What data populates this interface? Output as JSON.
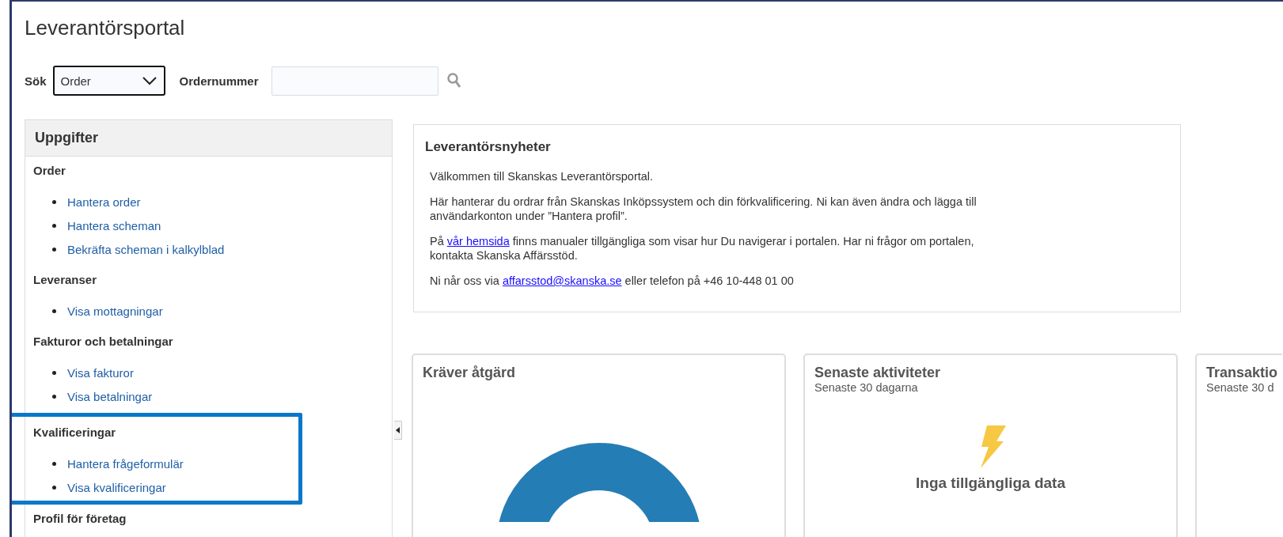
{
  "page": {
    "title": "Leverantörsportal"
  },
  "search": {
    "label": "Sök",
    "select_value": "Order",
    "field_label": "Ordernummer"
  },
  "tasks": {
    "title": "Uppgifter",
    "groups": [
      {
        "heading": "Order",
        "highlighted": false,
        "links": [
          "Hantera order",
          "Hantera scheman",
          "Bekräfta scheman i kalkylblad"
        ]
      },
      {
        "heading": "Leveranser",
        "highlighted": false,
        "links": [
          "Visa mottagningar"
        ]
      },
      {
        "heading": "Fakturor och betalningar",
        "highlighted": false,
        "links": [
          "Visa fakturor",
          "Visa betalningar"
        ]
      },
      {
        "heading": "Kvalificeringar",
        "highlighted": true,
        "links": [
          "Hantera frågeformulär",
          "Visa kvalificeringar"
        ]
      },
      {
        "heading": "Profil för företag",
        "highlighted": false
      }
    ]
  },
  "news": {
    "title": "Leverantörsnyheter",
    "paragraphs": [
      [
        {
          "text": "Välkommen till Skanskas Leverantörsportal.",
          "link": false
        }
      ],
      [
        {
          "text": "Här hanterar du ordrar från Skanskas Inköpssystem och din förkvalificering. Ni kan även ändra och lägga till användarkonton under ”Hantera profil”.",
          "link": false
        }
      ],
      [
        {
          "text": "På ",
          "link": false
        },
        {
          "text": "vår hemsida",
          "link": true
        },
        {
          "text": " finns manualer tillgängliga som visar hur Du navigerar i portalen. Har ni frågor om portalen, kontakta Skanska Affärsstöd.",
          "link": false
        }
      ],
      [
        {
          "text": "Ni når oss via ",
          "link": false
        },
        {
          "text": "affarsstod@skanska.se",
          "link": true
        },
        {
          "text": " eller telefon på +46 10-448 01 00",
          "link": false
        }
      ]
    ]
  },
  "cards": [
    {
      "kind": "donut",
      "title": "Kräver åtgärd"
    },
    {
      "kind": "empty",
      "title": "Senaste aktiviteter",
      "subtitle": "Senaste 30 dagarna",
      "message": "Inga tillgängliga data"
    },
    {
      "kind": "cut",
      "title": "Transaktio",
      "subtitle": "Senaste 30 d"
    }
  ]
}
